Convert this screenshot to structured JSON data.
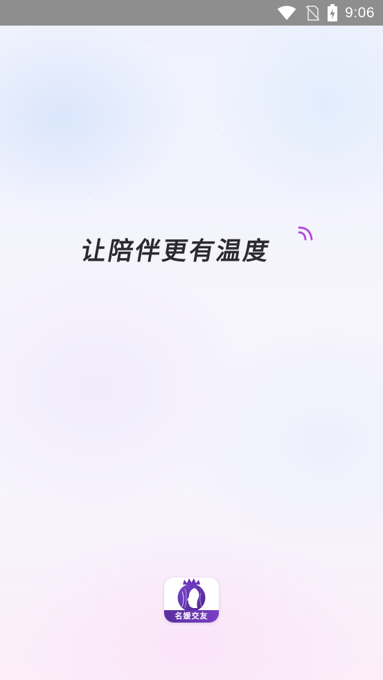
{
  "status_bar": {
    "time": "9:06",
    "icons": [
      "wifi-icon",
      "no-sim-icon",
      "battery-charging-icon"
    ]
  },
  "splash": {
    "slogan": "让陪伴更有温度",
    "accent_color": "#b44be0"
  },
  "app_logo": {
    "name": "名媛交友",
    "icon": "woman-with-crown-icon",
    "brand_color": "#6a35b8"
  }
}
